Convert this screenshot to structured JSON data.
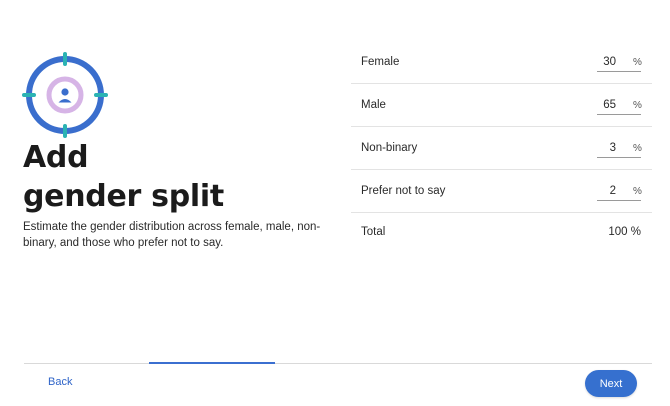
{
  "icon": {
    "name": "target-person-icon",
    "ring_color": "#3a6ecd",
    "crosshair_color": "#2bb3b3",
    "inner_ring_color": "#d6b4e6",
    "person_color": "#3a6ecd"
  },
  "heading": {
    "line1": "Add",
    "line2": "gender split"
  },
  "description": "Estimate the gender distribution across female, male, non-binary, and those who prefer not to say.",
  "form": {
    "rows": [
      {
        "label": "Female",
        "value": "30",
        "unit": "%"
      },
      {
        "label": "Male",
        "value": "65",
        "unit": "%"
      },
      {
        "label": "Non-binary",
        "value": "3",
        "unit": "%"
      },
      {
        "label": "Prefer not to say",
        "value": "2",
        "unit": "%"
      }
    ],
    "total": {
      "label": "Total",
      "value": "100 %"
    }
  },
  "progress": {
    "current_step": 2,
    "total_steps": 5,
    "fraction": 0.2,
    "color": "#3b6fd0"
  },
  "footer": {
    "back_label": "Back",
    "next_label": "Next"
  }
}
